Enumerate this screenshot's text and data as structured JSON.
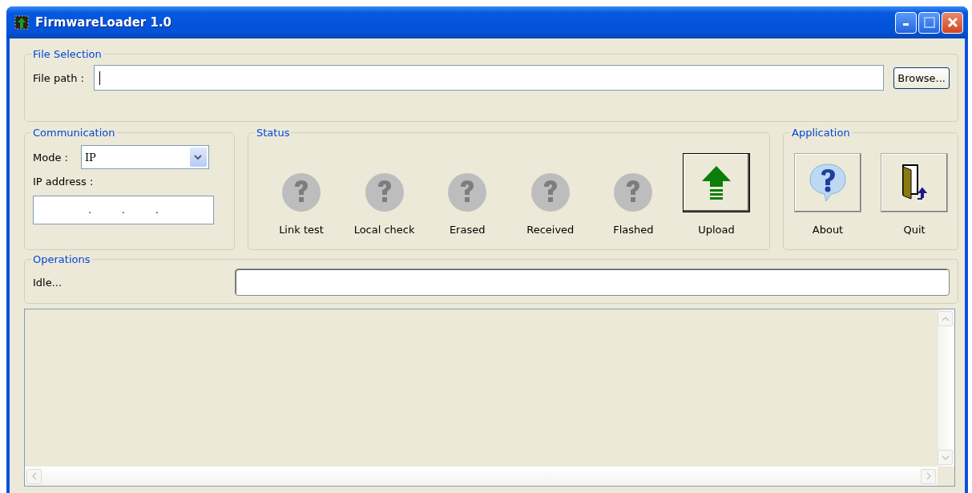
{
  "window": {
    "title": "FirmwareLoader 1.0"
  },
  "file_selection": {
    "legend": "File Selection",
    "label": "File path :",
    "path_field": {
      "focused": true
    },
    "browse_button": "Browse..."
  },
  "communication": {
    "legend": "Communication",
    "mode_label": "Mode :",
    "mode_value": "IP",
    "ip_label": "IP address :",
    "ip_separators": [
      ".",
      ".",
      "."
    ]
  },
  "status": {
    "legend": "Status",
    "steps": [
      {
        "label": "Link test",
        "kind": "unknown"
      },
      {
        "label": "Local check",
        "kind": "unknown"
      },
      {
        "label": "Erased",
        "kind": "unknown"
      },
      {
        "label": "Received",
        "kind": "unknown"
      },
      {
        "label": "Flashed",
        "kind": "unknown"
      }
    ],
    "upload_button": "Upload"
  },
  "application": {
    "legend": "Application",
    "buttons": [
      {
        "label": "About",
        "kind": "about"
      },
      {
        "label": "Quit",
        "kind": "quit"
      }
    ]
  },
  "operations": {
    "legend": "Operations",
    "status_text": "Idle...",
    "progress": {
      "level": 0
    }
  }
}
